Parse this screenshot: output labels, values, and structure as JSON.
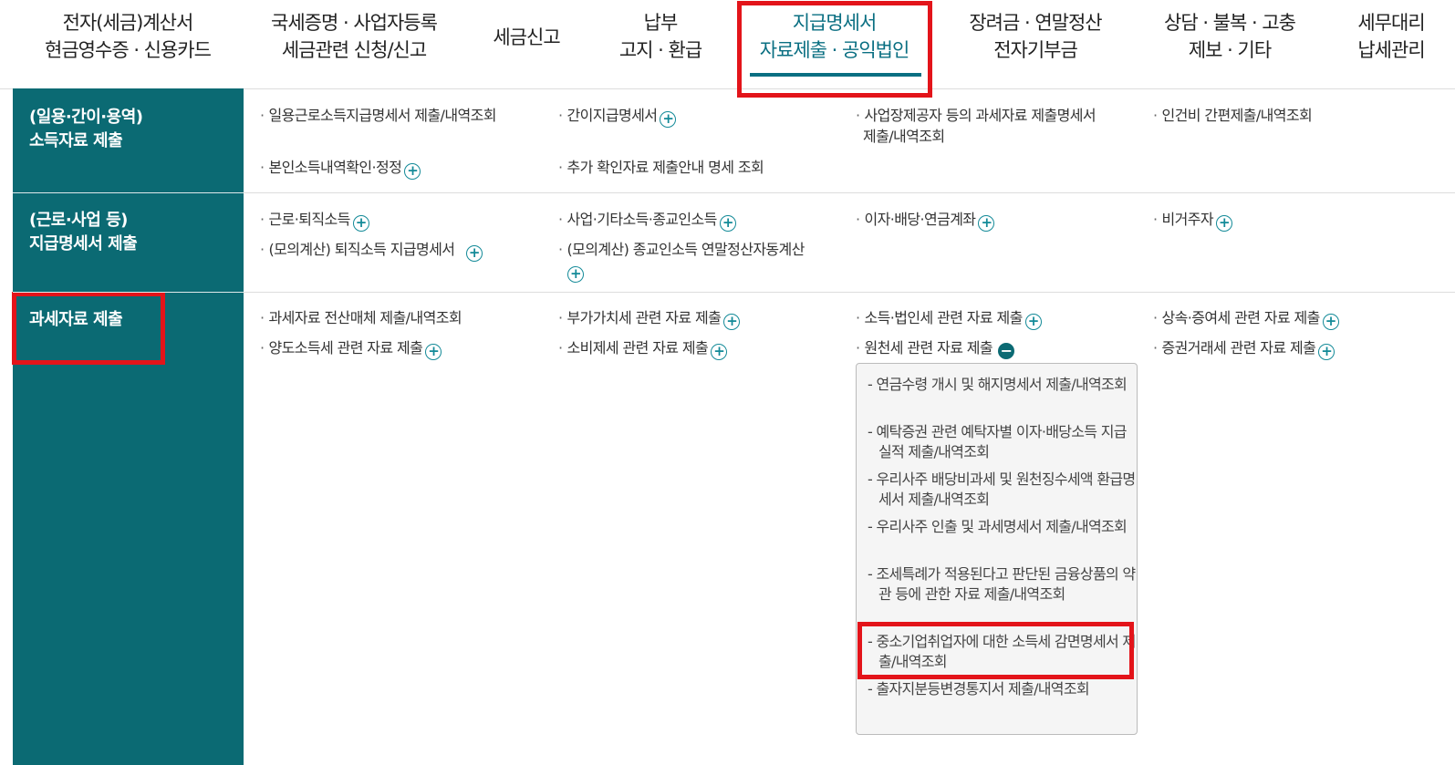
{
  "nav": [
    {
      "l1": "전자(세금)계산서",
      "l2": "현금영수증 · 신용카드"
    },
    {
      "l1": "국세증명 · 사업자등록",
      "l2": "세금관련 신청/신고"
    },
    {
      "l1": "세금신고",
      "l2": ""
    },
    {
      "l1": "납부",
      "l2": "고지 · 환급"
    },
    {
      "l1": "지급명세서",
      "l2": "자료제출 · 공익법인"
    },
    {
      "l1": "장려금 · 연말정산",
      "l2": "전자기부금"
    },
    {
      "l1": "상담 · 불복 · 고충",
      "l2": "제보 · 기타"
    },
    {
      "l1": "세무대리",
      "l2": "납세관리"
    }
  ],
  "sections": {
    "s1": {
      "l1": "(일용·간이·용역)",
      "l2": "소득자료 제출"
    },
    "s2": {
      "l1": "(근로·사업 등)",
      "l2": "지급명세서 제출"
    },
    "s3": {
      "l1": "과세자료 제출"
    }
  },
  "links": {
    "a1": "일용근로소득지급명세서 제출/내역조회",
    "a2": "간이지급명세서",
    "a3": "사업장제공자 등의 과세자료 제출명세서",
    "a3b": "제출/내역조회",
    "a4": "인건비 간편제출/내역조회",
    "a5": "본인소득내역확인·정정",
    "a6": "추가 확인자료 제출안내 명세 조회",
    "b1": "근로·퇴직소득",
    "b2": "사업·기타소득·종교인소득",
    "b3": "이자·배당·연금계좌",
    "b4": "비거주자",
    "b5": "(모의계산) 퇴직소득 지급명세서",
    "b6": "(모의계산) 종교인소득 연말정산자동계산",
    "c1": "과세자료 전산매체 제출/내역조회",
    "c2": "부가가치세 관련 자료 제출",
    "c3": "소득·법인세 관련 자료 제출",
    "c4": "상속·증여세 관련 자료 제출",
    "c5": "양도소득세 관련 자료 제출",
    "c6": "소비제세 관련 자료 제출",
    "c7": "원천세 관련 자료 제출",
    "c8": "증권거래세 관련 자료 제출"
  },
  "submenu": [
    "- 연금수령 개시 및 해지명세서 제출/내역조회",
    "- 예탁증권 관련 예탁자별 이자·배당소득 지급 실적 제출/내역조회",
    "- 우리사주 배당비과세 및 원천징수세액 환급명세서 제출/내역조회",
    "- 우리사주 인출 및 과세명세서 제출/내역조회",
    "- 조세특례가 적용된다고 판단된 금융상품의 약관 등에 관한 자료 제출/내역조회",
    "- 중소기업취업자에 대한 소득세 감면명세서 제출/내역조회",
    "- 출자지분등변경통지서 제출/내역조회"
  ],
  "icons": {
    "plus": "+",
    "minus": "−",
    "bullet": "·"
  },
  "colors": {
    "accent": "#0b6a73",
    "highlight": "#e3141a"
  }
}
